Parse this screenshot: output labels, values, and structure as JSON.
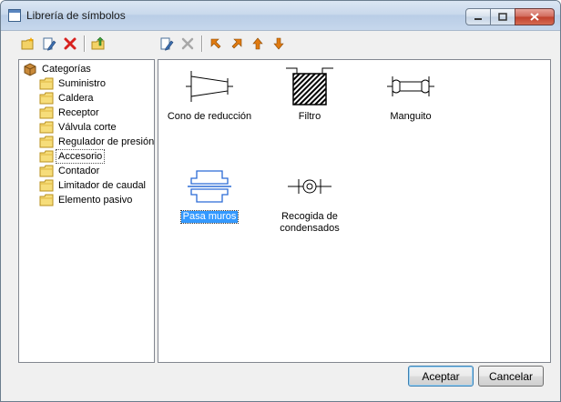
{
  "window": {
    "title": "Librería de símbolos"
  },
  "tree": {
    "root_label": "Categorías",
    "items": [
      {
        "label": "Suministro"
      },
      {
        "label": "Caldera"
      },
      {
        "label": "Receptor"
      },
      {
        "label": "Válvula corte"
      },
      {
        "label": "Regulador de presión"
      },
      {
        "label": "Accesorio"
      },
      {
        "label": "Contador"
      },
      {
        "label": "Limitador de caudal"
      },
      {
        "label": "Elemento pasivo"
      }
    ],
    "selected": "Accesorio"
  },
  "symbols": [
    {
      "label": "Cono de reducción"
    },
    {
      "label": "Filtro"
    },
    {
      "label": "Manguito"
    },
    {
      "label": "Pasa muros"
    },
    {
      "label": "Recogida de condensados"
    }
  ],
  "selected_symbol": "Pasa muros",
  "buttons": {
    "accept": "Aceptar",
    "cancel": "Cancelar"
  },
  "icons": {
    "toolbar_left": [
      "new-folder-icon",
      "edit-icon",
      "delete-icon",
      "folder-up-icon"
    ],
    "toolbar_right": [
      "edit-symbol-icon",
      "delete-symbol-icon",
      "move-first-icon",
      "move-last-icon",
      "move-up-icon",
      "move-down-icon"
    ]
  },
  "colors": {
    "accent": "#3399ff",
    "delete": "#d8221f",
    "arrow": "#e07a10"
  }
}
